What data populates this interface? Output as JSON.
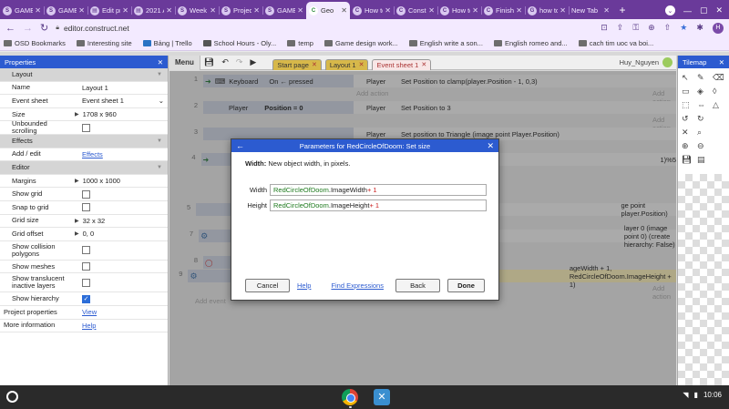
{
  "browser": {
    "tabs": [
      {
        "label": "GAME D",
        "fav": "S",
        "active": false
      },
      {
        "label": "GAME D",
        "fav": "S",
        "active": false
      },
      {
        "label": "Edit pro",
        "fav": "▤",
        "active": false
      },
      {
        "label": "2021 AI",
        "fav": "▤",
        "active": false
      },
      {
        "label": "Week 1",
        "fav": "S",
        "active": false
      },
      {
        "label": "Project",
        "fav": "S",
        "active": false
      },
      {
        "label": "GAME D",
        "fav": "S",
        "active": false
      },
      {
        "label": "Geo",
        "fav": "C",
        "active": true
      },
      {
        "label": "How to",
        "fav": "C",
        "active": false
      },
      {
        "label": "Constr",
        "fav": "C",
        "active": false
      },
      {
        "label": "How to",
        "fav": "C",
        "active": false
      },
      {
        "label": "Finishi",
        "fav": "C",
        "active": false
      },
      {
        "label": "how to",
        "fav": "G",
        "active": false
      },
      {
        "label": "New Tab",
        "fav": "",
        "active": false
      }
    ],
    "url": "editor.construct.net",
    "bookmarks": [
      {
        "label": "OSD Bookmarks",
        "icon": "folder"
      },
      {
        "label": "Interesting site",
        "icon": "folder"
      },
      {
        "label": "Bảng | Trello",
        "icon": "trello"
      },
      {
        "label": "School Hours - Oly...",
        "icon": "school"
      },
      {
        "label": "temp",
        "icon": "folder"
      },
      {
        "label": "Game design work...",
        "icon": "folder"
      },
      {
        "label": "English write a son...",
        "icon": "folder"
      },
      {
        "label": "English romeo and...",
        "icon": "folder"
      },
      {
        "label": "cach tim uoc va boi...",
        "icon": "folder"
      }
    ]
  },
  "editor": {
    "properties_title": "Properties",
    "properties": [
      {
        "type": "section",
        "label": "Layout"
      },
      {
        "type": "row",
        "key": "Name",
        "value": "Layout 1"
      },
      {
        "type": "select",
        "key": "Event sheet",
        "value": "Event sheet 1"
      },
      {
        "type": "expand",
        "key": "Size",
        "value": "1708 x 960"
      },
      {
        "type": "check",
        "key": "Unbounded scrolling",
        "checked": false
      },
      {
        "type": "section",
        "label": "Effects"
      },
      {
        "type": "link",
        "key": "Add / edit",
        "value": "Effects"
      },
      {
        "type": "section",
        "label": "Editor"
      },
      {
        "type": "expand",
        "key": "Margins",
        "value": "1000 x 1000"
      },
      {
        "type": "check",
        "key": "Show grid",
        "checked": false
      },
      {
        "type": "check",
        "key": "Snap to grid",
        "checked": false
      },
      {
        "type": "expand",
        "key": "Grid size",
        "value": "32 x 32"
      },
      {
        "type": "expand",
        "key": "Grid offset",
        "value": "0, 0"
      },
      {
        "type": "check",
        "key": "Show collision polygons",
        "checked": false,
        "tall": true
      },
      {
        "type": "check",
        "key": "Show meshes",
        "checked": false
      },
      {
        "type": "check",
        "key": "Show translucent inactive layers",
        "checked": false,
        "tall": true
      },
      {
        "type": "check",
        "key": "Show hierarchy",
        "checked": true
      },
      {
        "type": "link",
        "key": "Project properties",
        "value": "View",
        "top": true
      },
      {
        "type": "link",
        "key": "More information",
        "value": "Help",
        "top": true
      }
    ],
    "menu_label": "Menu",
    "editor_tabs": [
      {
        "label": "Start page",
        "style": "yellow"
      },
      {
        "label": "Layout 1",
        "style": "yellow"
      },
      {
        "label": "Event sheet 1",
        "style": "active"
      }
    ],
    "user": "Huy_Nguyen",
    "tilemap_title": "Tilemap",
    "add_action": "Add action",
    "add_event": "Add event",
    "events": [
      {
        "num": "1",
        "cond_obj": "Keyboard",
        "cond_txt": "On ← pressed",
        "act_obj": "Player",
        "act_txt": "Set Position to clamp(player.Position - 1, 0,3)"
      },
      {
        "num": "2",
        "cond_obj": "Player",
        "cond_txt": "Position = 0",
        "act_obj": "Player",
        "act_txt": "Set Position to 3"
      },
      {
        "num": "3",
        "cond_obj": "",
        "cond_txt": "",
        "act_obj": "Player",
        "act_txt": "Set position to Triangle (image point Player.Position)"
      },
      {
        "num": "4",
        "cond_obj": "",
        "cond_txt": "",
        "act_obj": "",
        "act_txt": "1)%5"
      },
      {
        "num": "5",
        "cond_obj": "",
        "cond_txt": "",
        "act_obj": "",
        "act_txt": "ge point player.Position)"
      },
      {
        "num": "7",
        "cond_obj": "",
        "cond_txt": "",
        "act_obj": "",
        "act_txt": "layer 0 (image point 0) (create hierarchy: False)"
      },
      {
        "num": "8",
        "cond_obj": "",
        "cond_txt": "",
        "act_obj": "",
        "act_txt": ""
      },
      {
        "num": "9",
        "cond_obj": "",
        "cond_txt": "",
        "act_obj": "",
        "act_txt": "ageWidth + 1, RedCircleOfDoom.ImageHeight + 1)"
      }
    ]
  },
  "dialog": {
    "title": "Parameters for RedCircleOfDoom: Set size",
    "desc_label": "Width:",
    "desc_text": "New object width, in pixels.",
    "width_label": "Width",
    "width_value_obj": "RedCircleOfDoom",
    "width_value_prop": ".ImageWidth",
    "width_value_op": " + 1",
    "height_label": "Height",
    "height_value_obj": "RedCircleOfDoom",
    "height_value_prop": ".ImageHeight",
    "height_value_op": " + 1",
    "cancel": "Cancel",
    "help": "Help",
    "find_expressions": "Find Expressions",
    "back": "Back",
    "done": "Done"
  },
  "shelf": {
    "time": "10:06"
  }
}
